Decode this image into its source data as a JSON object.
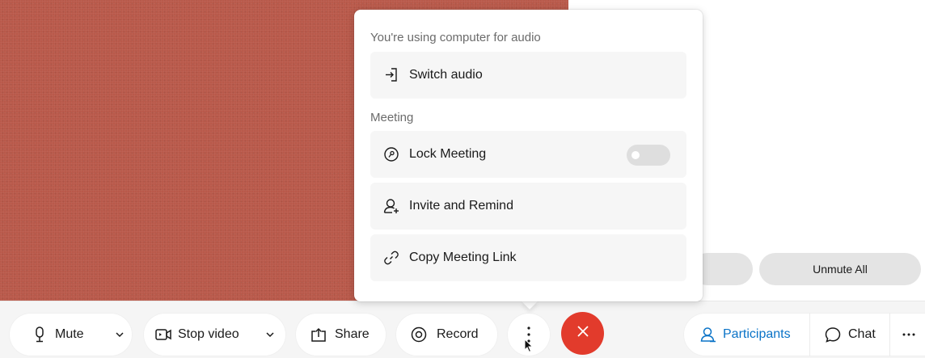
{
  "popup": {
    "audio_section_label": "You're using computer for audio",
    "switch_audio_label": "Switch audio",
    "meeting_section_label": "Meeting",
    "lock_meeting_label": "Lock Meeting",
    "lock_meeting_enabled": false,
    "invite_remind_label": "Invite and Remind",
    "copy_link_label": "Copy Meeting Link"
  },
  "panel": {
    "unmute_all_label": "Unmute All"
  },
  "toolbar": {
    "mute_label": "Mute",
    "stop_video_label": "Stop video",
    "share_label": "Share",
    "record_label": "Record",
    "participants_label": "Participants",
    "chat_label": "Chat"
  },
  "colors": {
    "end_call": "#e23b2c",
    "participants_accent": "#0a73c7",
    "video_background": "#b9594a"
  },
  "icons": {
    "mute": "microphone-icon",
    "stop_video": "video-camera-icon",
    "share": "share-icon",
    "record": "record-icon",
    "more": "more-vertical-icon",
    "end": "close-icon",
    "participants": "participants-icon",
    "chat": "chat-icon",
    "overflow": "more-horizontal-icon"
  }
}
